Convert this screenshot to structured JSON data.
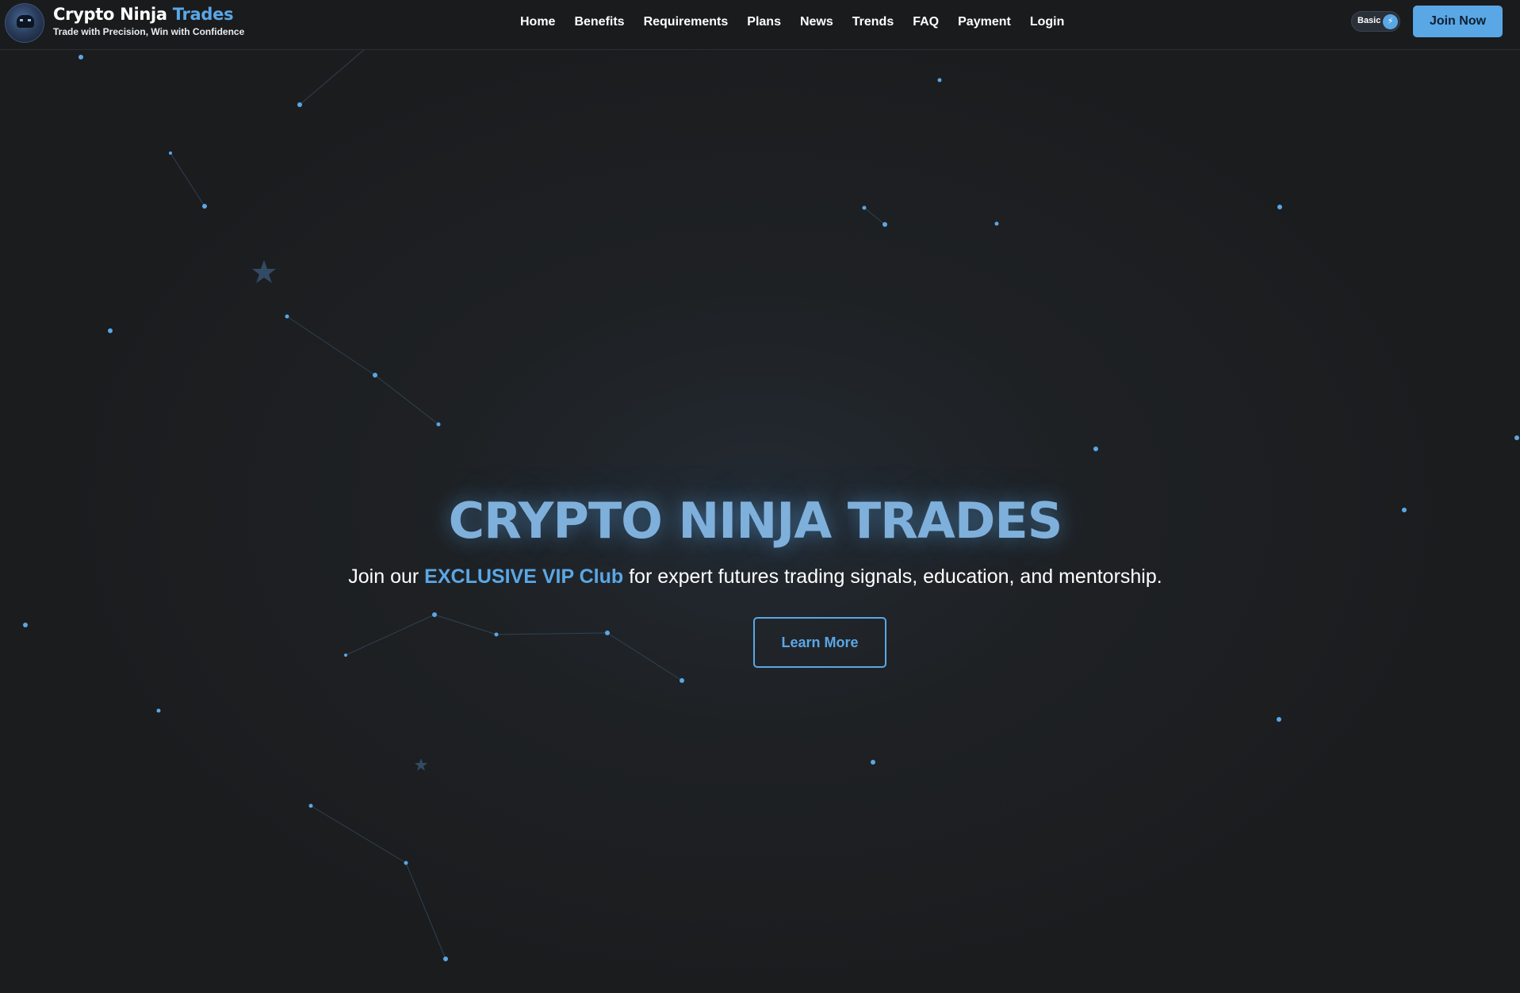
{
  "header": {
    "brand_name": "Crypto Ninja",
    "brand_accent": "Trades",
    "tagline": "Trade with Precision, Win with Confidence",
    "nav": [
      "Home",
      "Benefits",
      "Requirements",
      "Plans",
      "News",
      "Trends",
      "FAQ",
      "Payment",
      "Login"
    ],
    "theme_toggle_label": "Basic",
    "theme_toggle_icon": "bolt-icon",
    "cta_label": "Join Now"
  },
  "hero": {
    "title": "CRYPTO NINJA TRADES",
    "subtitle_before": "Join our ",
    "subtitle_highlight": "EXCLUSIVE VIP Club",
    "subtitle_after": " for expert futures trading signals, education, and mentorship.",
    "button_label": "Learn More"
  },
  "colors": {
    "accent": "#5aa7e6",
    "background": "#1c1d1f",
    "header_bg": "#1a1b1d",
    "text": "#ffffff"
  }
}
